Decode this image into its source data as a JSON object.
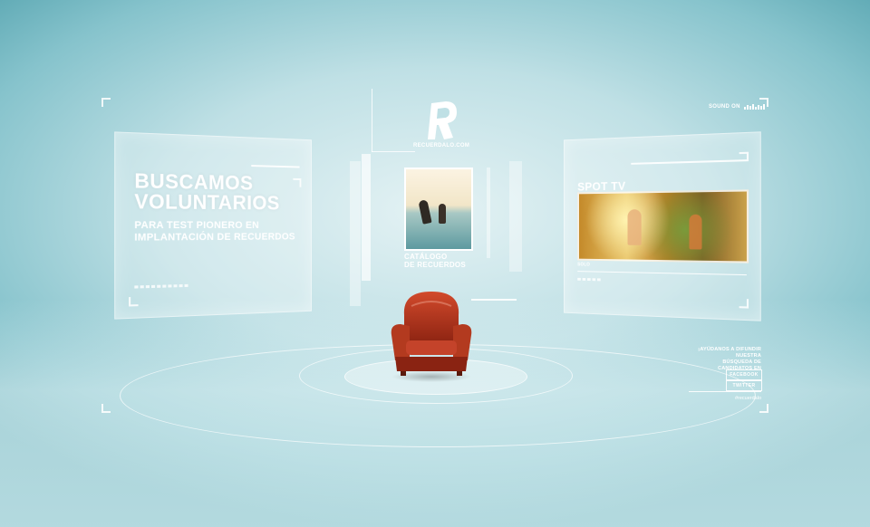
{
  "left_panel": {
    "headline_line1": "BUSCAMOS",
    "headline_line2": "VOLUNTARIOS",
    "sub_line1": "PARA TEST PIONERO EN",
    "sub_line2": "IMPLANTACIÓN DE RECUERDOS"
  },
  "center": {
    "logo_letter": "R",
    "site": "RECUERDALO.COM",
    "catalog_line1": "CATÁLOGO",
    "catalog_line2": "DE RECUERDOS"
  },
  "right_panel": {
    "title": "SPOT TV",
    "small_label": "SOLO"
  },
  "sound": {
    "label": "SOUND ON"
  },
  "social": {
    "text_line1": "¡AYÚDANOS A DIFUNDIR NUESTRA",
    "text_line2": "BÚSQUEDA DE CANDIDATOS EN",
    "facebook": "FACEBOOK",
    "twitter": "TWITTER",
    "hashtag": "#recuerdalo"
  },
  "colors": {
    "chair": "#b8321c",
    "background_teal": "#86c3cc",
    "panel_white": "#ffffff"
  }
}
